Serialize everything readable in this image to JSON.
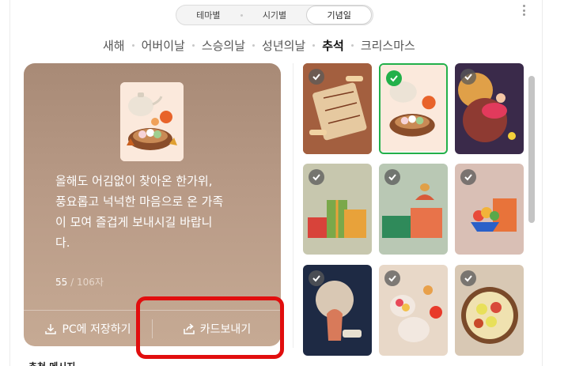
{
  "tabs": [
    {
      "label": "테마별",
      "active": false
    },
    {
      "label": "시기별",
      "active": false
    },
    {
      "label": "기념일",
      "active": true
    }
  ],
  "occasions": [
    {
      "label": "새해",
      "active": false
    },
    {
      "label": "어버이날",
      "active": false
    },
    {
      "label": "스승의날",
      "active": false
    },
    {
      "label": "성년의날",
      "active": false
    },
    {
      "label": "추석",
      "active": true
    },
    {
      "label": "크리스마스",
      "active": false
    }
  ],
  "preview": {
    "message": "올해도 어김없이 찾아온 한가위,\n풍요롭고 넉넉한 마음으로 온 가족\n이 모여 즐겁게 보내시길 바랍니\n다.",
    "count": "55",
    "max": " / 106자",
    "save_label": "PC에 저장하기",
    "send_label": "카드보내기"
  },
  "bottom_label": "추천 메시지",
  "cards": [
    {
      "id": "yut",
      "selected": false
    },
    {
      "id": "teapot",
      "selected": true
    },
    {
      "id": "moon-girl",
      "selected": false
    },
    {
      "id": "gift-boxes",
      "selected": false
    },
    {
      "id": "fruit-gifts",
      "selected": false
    },
    {
      "id": "fruit-bowl",
      "selected": false
    },
    {
      "id": "moon-night",
      "selected": false
    },
    {
      "id": "fruit-plate",
      "selected": false
    },
    {
      "id": "jeon-plate",
      "selected": false
    }
  ],
  "colors": {
    "accent_green": "#22b04a",
    "highlight_red": "#e10e0e"
  }
}
